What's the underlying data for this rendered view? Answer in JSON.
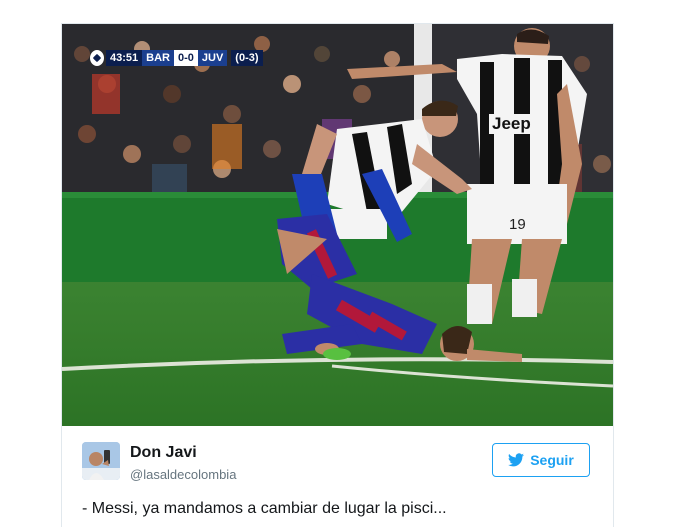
{
  "media": {
    "scoreboard": {
      "clock": "43:51",
      "home_team": "BAR",
      "score": "0-0",
      "away_team": "JUV",
      "aggregate": "(0-3)"
    },
    "sponsor": "Jeep",
    "shirt_number": "19"
  },
  "tweet": {
    "user_name": "Don Javi",
    "user_handle": "@lasaldecolombia",
    "follow_label": "Seguir",
    "text": "- Messi, ya mandamos a cambiar de lugar la pisci..."
  },
  "colors": {
    "twitter_blue": "#1da1f2",
    "text_primary": "#14171a",
    "text_secondary": "#66757f"
  }
}
